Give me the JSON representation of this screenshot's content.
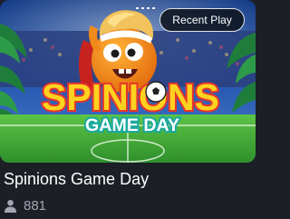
{
  "game": {
    "title": "Spinions Game Day",
    "badge": "Recent Play",
    "players": "881",
    "logo": {
      "line1": "SPINIONS",
      "line2": "GAME DAY"
    }
  },
  "icons": {
    "players": "person-icon"
  },
  "colors": {
    "background": "#1c1f26",
    "pitch": "#3fae3a",
    "logo_yellow": "#ffd21f",
    "logo_red": "#e6342c",
    "logo_teal": "#1ba9a0"
  }
}
